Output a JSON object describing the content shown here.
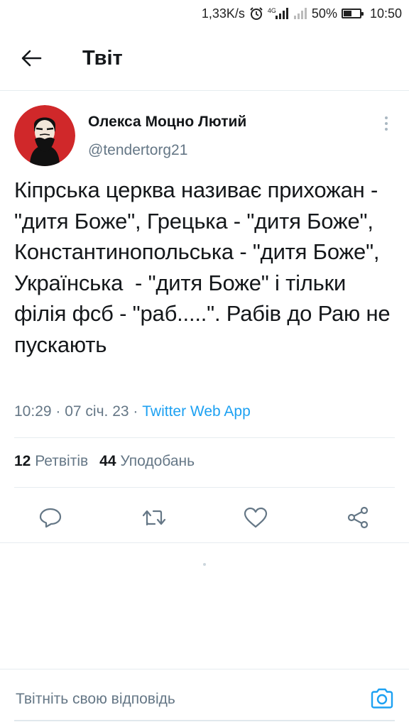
{
  "status_bar": {
    "speed": "1,33K/s",
    "network_type": "4G",
    "battery": "50%",
    "battery_level": 0.5,
    "time": "10:50",
    "icons": [
      "alarm-icon",
      "signal-icon",
      "signal-weak-icon",
      "battery-icon"
    ]
  },
  "header": {
    "title": "Твіт",
    "back_icon": "arrow-left-icon"
  },
  "tweet": {
    "author_name": "Олекса Моцно Лютий",
    "author_handle": "@tendertorg21",
    "text": "Кіпрська церква називає прихожан - \"дитя Боже\", Грецька - \"дитя Боже\", Константинопольська - \"дитя Боже\", Українська  - \"дитя Боже\" і тільки філія фсб - \"раб.....\". Рабів до Раю не пускають",
    "time": "10:29",
    "separator": " · ",
    "date": "07 січ. 23",
    "source": "Twitter Web App",
    "retweets_count": "12",
    "retweets_label": "Ретвітів",
    "likes_count": "44",
    "likes_label": "Уподобань"
  },
  "actions": {
    "icons": [
      "reply-icon",
      "retweet-icon",
      "like-icon",
      "share-icon"
    ]
  },
  "reply_bar": {
    "placeholder": "Твітніть свою відповідь",
    "camera_icon": "camera-icon"
  },
  "colors": {
    "accent": "#1da1f2",
    "secondary_text": "#657786",
    "primary_text": "#14171a",
    "divider": "#e6ecf0",
    "avatar_red": "#d0282a"
  }
}
